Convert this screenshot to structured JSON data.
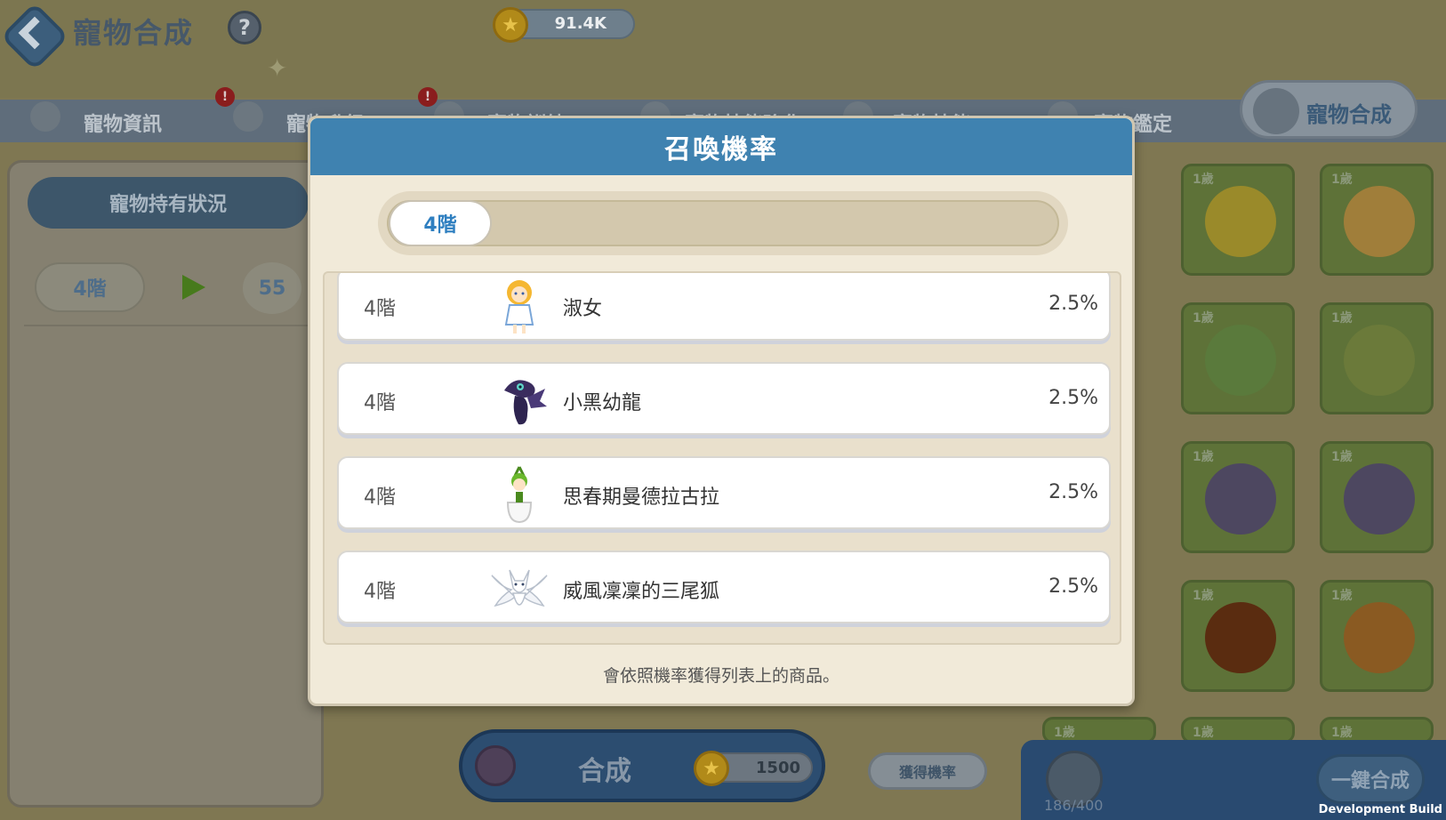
{
  "header": {
    "title": "寵物合成",
    "help_label": "?",
    "coins": "91.4K"
  },
  "tabs": [
    {
      "label": "寵物資訊",
      "alert": ""
    },
    {
      "label": "寵物升級",
      "alert": "!"
    },
    {
      "label": "寵物訓練",
      "alert": "!"
    },
    {
      "label": "寵物技能強化",
      "alert": ""
    },
    {
      "label": "寵物技能",
      "alert": ""
    },
    {
      "label": "寵物鑑定",
      "alert": ""
    }
  ],
  "active_tab": "寵物合成",
  "left_panel": {
    "title": "寵物持有狀況",
    "stage": "4階",
    "count": "55"
  },
  "grid": {
    "age_label": "1歲"
  },
  "bottom": {
    "synth_label": "合成",
    "synth_cost": "1500",
    "prob_button": "獲得機率",
    "capacity": "186/400",
    "one_click": "一鍵合成",
    "dev_build": "Development Build"
  },
  "modal": {
    "title": "召喚機率",
    "filter": "4階",
    "note": "會依照機率獲得列表上的商品。",
    "rows": [
      {
        "tier": "4階",
        "name": "淑女",
        "rate": "2.5%",
        "icon": "lady-pet-icon"
      },
      {
        "tier": "4階",
        "name": "小黑幼龍",
        "rate": "2.5%",
        "icon": "black-dragon-pet-icon"
      },
      {
        "tier": "4階",
        "name": "思春期曼德拉古拉",
        "rate": "2.5%",
        "icon": "mandragora-pet-icon"
      },
      {
        "tier": "4階",
        "name": "威風凜凜的三尾狐",
        "rate": "2.5%",
        "icon": "three-tail-fox-pet-icon"
      }
    ]
  },
  "colors": {
    "modal_header": "#3f82b0",
    "chip_text": "#2f7fc0",
    "backdrop": "#7f7752"
  }
}
